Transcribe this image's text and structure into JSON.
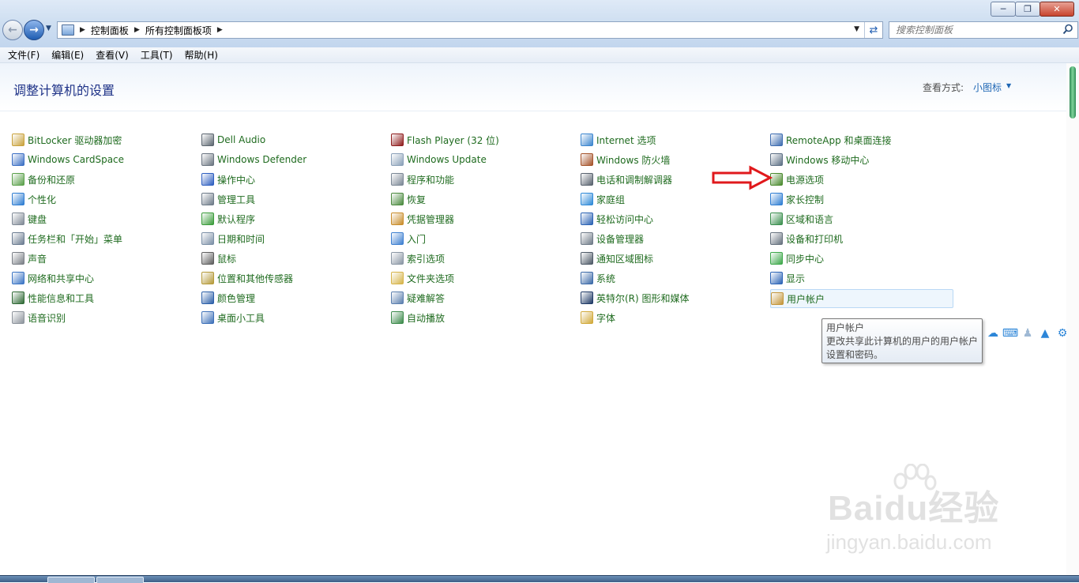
{
  "window": {
    "caption_buttons": [
      "minimize",
      "maximize",
      "close"
    ]
  },
  "address_bar": {
    "breadcrumbs": [
      "控制面板",
      "所有控制面板项"
    ]
  },
  "search": {
    "placeholder": "搜索控制面板"
  },
  "menu": [
    "文件(F)",
    "编辑(E)",
    "查看(V)",
    "工具(T)",
    "帮助(H)"
  ],
  "header": {
    "title": "调整计算机的设置",
    "view_label": "查看方式:",
    "view_value": "小图标"
  },
  "columns": [
    [
      {
        "label": "BitLocker 驱动器加密",
        "icon": "bitlocker-icon",
        "color": "#c9a23c"
      },
      {
        "label": "Windows CardSpace",
        "icon": "cardspace-icon",
        "color": "#3b6fc4"
      },
      {
        "label": "备份和还原",
        "icon": "backup-icon",
        "color": "#5aa04a"
      },
      {
        "label": "个性化",
        "icon": "personalization-icon",
        "color": "#2e7dd2"
      },
      {
        "label": "键盘",
        "icon": "keyboard-icon",
        "color": "#808a96"
      },
      {
        "label": "任务栏和「开始」菜单",
        "icon": "taskbar-icon",
        "color": "#6b7c91"
      },
      {
        "label": "声音",
        "icon": "sound-icon",
        "color": "#7a7f86"
      },
      {
        "label": "网络和共享中心",
        "icon": "network-icon",
        "color": "#3a74c4"
      },
      {
        "label": "性能信息和工具",
        "icon": "performance-icon",
        "color": "#2f6a35"
      },
      {
        "label": "语音识别",
        "icon": "microphone-icon",
        "color": "#8d949c"
      }
    ],
    [
      {
        "label": "Dell Audio",
        "icon": "dell-audio-icon",
        "color": "#5c6670"
      },
      {
        "label": "Windows Defender",
        "icon": "defender-icon",
        "color": "#6a7480"
      },
      {
        "label": "操作中心",
        "icon": "action-center-flag-icon",
        "color": "#2d5ec0"
      },
      {
        "label": "管理工具",
        "icon": "admin-tools-icon",
        "color": "#6d7a88"
      },
      {
        "label": "默认程序",
        "icon": "default-programs-icon",
        "color": "#3b9c3b"
      },
      {
        "label": "日期和时间",
        "icon": "clock-icon",
        "color": "#7b8fa6"
      },
      {
        "label": "鼠标",
        "icon": "mouse-icon",
        "color": "#5e5e5e"
      },
      {
        "label": "位置和其他传感器",
        "icon": "sensor-icon",
        "color": "#b59a3a"
      },
      {
        "label": "颜色管理",
        "icon": "color-management-icon",
        "color": "#2b5fa8"
      },
      {
        "label": "桌面小工具",
        "icon": "gadgets-icon",
        "color": "#3d70b8"
      }
    ],
    [
      {
        "label": "Flash Player (32 位)",
        "icon": "flash-icon",
        "color": "#8f1d1d"
      },
      {
        "label": "Windows Update",
        "icon": "windows-update-icon",
        "color": "#8aa0b8"
      },
      {
        "label": "程序和功能",
        "icon": "programs-icon",
        "color": "#7b8795"
      },
      {
        "label": "恢复",
        "icon": "recovery-icon",
        "color": "#4a8a3e"
      },
      {
        "label": "凭据管理器",
        "icon": "credential-icon",
        "color": "#c98d2b"
      },
      {
        "label": "入门",
        "icon": "getting-started-icon",
        "color": "#3d7fd0"
      },
      {
        "label": "索引选项",
        "icon": "indexing-icon",
        "color": "#8a96a4"
      },
      {
        "label": "文件夹选项",
        "icon": "folder-options-icon",
        "color": "#d6b44a"
      },
      {
        "label": "疑难解答",
        "icon": "troubleshoot-icon",
        "color": "#5b7fae"
      },
      {
        "label": "自动播放",
        "icon": "autoplay-icon",
        "color": "#3b8a4a"
      }
    ],
    [
      {
        "label": "Internet 选项",
        "icon": "internet-options-icon",
        "color": "#3c86cf"
      },
      {
        "label": "Windows 防火墙",
        "icon": "firewall-icon",
        "color": "#a5532a"
      },
      {
        "label": "电话和调制解调器",
        "icon": "phone-modem-icon",
        "color": "#58626e"
      },
      {
        "label": "家庭组",
        "icon": "homegroup-icon",
        "color": "#2f8ad8"
      },
      {
        "label": "轻松访问中心",
        "icon": "ease-of-access-icon",
        "color": "#2c63b4"
      },
      {
        "label": "设备管理器",
        "icon": "device-manager-icon",
        "color": "#6f7b88"
      },
      {
        "label": "通知区域图标",
        "icon": "notification-area-icon",
        "color": "#4d5966"
      },
      {
        "label": "系统",
        "icon": "system-icon",
        "color": "#3c6aa8"
      },
      {
        "label": "英特尔(R) 图形和媒体",
        "icon": "intel-graphics-icon",
        "color": "#1f3a66"
      },
      {
        "label": "字体",
        "icon": "fonts-icon",
        "color": "#d1a93a"
      }
    ],
    [
      {
        "label": "RemoteApp 和桌面连接",
        "icon": "remoteapp-icon",
        "color": "#3d6cb0"
      },
      {
        "label": "Windows 移动中心",
        "icon": "mobility-center-icon",
        "color": "#5c6f84"
      },
      {
        "label": "电源选项",
        "icon": "power-options-icon",
        "color": "#4a8a2e"
      },
      {
        "label": "家长控制",
        "icon": "parental-controls-icon",
        "color": "#2f7ed3"
      },
      {
        "label": "区域和语言",
        "icon": "region-language-icon",
        "color": "#3a8f4e"
      },
      {
        "label": "设备和打印机",
        "icon": "devices-printers-icon",
        "color": "#66717e"
      },
      {
        "label": "同步中心",
        "icon": "sync-center-icon",
        "color": "#3da84a"
      },
      {
        "label": "显示",
        "icon": "display-icon",
        "color": "#2c64b6"
      },
      {
        "label": "用户帐户",
        "icon": "user-accounts-icon",
        "color": "#c3953a"
      }
    ]
  ],
  "tooltip": {
    "title": "用户帐户",
    "line1": "更改共享此计算机的用户的用户帐户",
    "line2": "设置和密码。"
  },
  "watermark": {
    "brand": "Baidu经验",
    "url": "jingyan.baidu.com"
  }
}
